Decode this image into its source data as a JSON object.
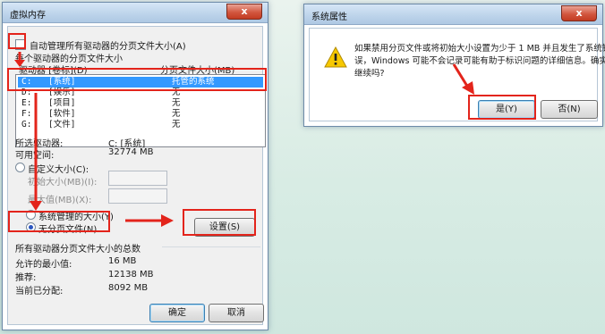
{
  "vm_dialog": {
    "title": "虚拟内存",
    "close": "x",
    "auto_manage_label": "自动管理所有驱动器的分页文件大小(A)",
    "per_drive_heading": "每个驱动器的分页文件大小",
    "col_drive": "驱动器 [卷标](D)",
    "col_size": "分页文件大小(MB)",
    "drives": [
      {
        "drive": "C:",
        "label": "[系统]",
        "size": "托管的系统"
      },
      {
        "drive": "D:",
        "label": "[娱乐]",
        "size": "无"
      },
      {
        "drive": "E:",
        "label": "[项目]",
        "size": "无"
      },
      {
        "drive": "F:",
        "label": "[软件]",
        "size": "无"
      },
      {
        "drive": "G:",
        "label": "[文件]",
        "size": "无"
      }
    ],
    "selected_drive_label": "所选驱动器:",
    "selected_drive_value": "C: [系统]",
    "free_space_label": "可用空间:",
    "free_space_value": "32774 MB",
    "custom_size": "自定义大小(C):",
    "initial_size": "初始大小(MB)(I):",
    "max_size": "最大值(MB)(X):",
    "system_managed": "系统管理的大小(Y)",
    "no_paging": "无分页文件(N)",
    "set_button": "设置(S)",
    "totals_heading": "所有驱动器分页文件大小的总数",
    "min_allowed_label": "允许的最小值:",
    "min_allowed_value": "16 MB",
    "recommended_label": "推荐:",
    "recommended_value": "12138 MB",
    "allocated_label": "当前已分配:",
    "allocated_value": "8092 MB",
    "ok_button": "确定",
    "cancel_button": "取消"
  },
  "sys_dialog": {
    "title": "系统属性",
    "close": "x",
    "message_line1": "如果禁用分页文件或将初始大小设置为少于 1 MB 并且发生了系统错",
    "message_line2": "误，Windows 可能不会记录可能有助于标识问题的详细信息。确实要",
    "message_line3": "继续吗?",
    "yes_button": "是(Y)",
    "no_button": "否(N)",
    "icon": "warning-icon"
  },
  "colors": {
    "highlight": "#e3241b",
    "selection": "#3399ff"
  }
}
